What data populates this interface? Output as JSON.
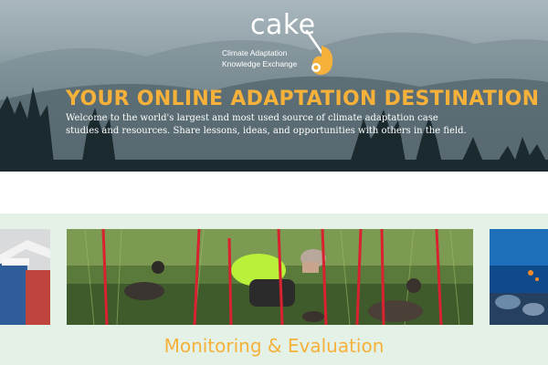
{
  "brand": {
    "logo_word": "cake",
    "logo_line1": "Climate Adaptation",
    "logo_line2": "Knowledge Exchange"
  },
  "hero": {
    "title": "YOUR ONLINE ADAPTATION DESTINATION",
    "text": "Welcome to the world's largest and most used source of climate adaptation case studies and resources. Share lessons, ideas, and opportunities with others in the field."
  },
  "carousel": {
    "current_caption": "Monitoring & Evaluation"
  },
  "colors": {
    "accent": "#f5b13a",
    "carousel_bg": "#e4f1e7"
  }
}
